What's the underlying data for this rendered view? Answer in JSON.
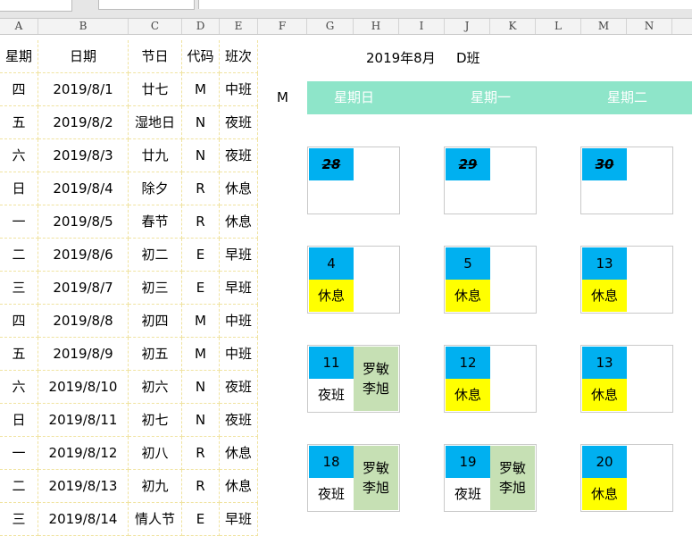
{
  "columns": [
    "A",
    "B",
    "C",
    "D",
    "E",
    "F",
    "G",
    "H",
    "I",
    "J",
    "K",
    "L",
    "M",
    "N"
  ],
  "table": {
    "headers": [
      "星期",
      "日期",
      "节日",
      "代码",
      "班次"
    ],
    "rows": [
      [
        "四",
        "2019/8/1",
        "廿七",
        "M",
        "中班"
      ],
      [
        "五",
        "2019/8/2",
        "湿地日",
        "N",
        "夜班"
      ],
      [
        "六",
        "2019/8/3",
        "廿九",
        "N",
        "夜班"
      ],
      [
        "日",
        "2019/8/4",
        "除夕",
        "R",
        "休息"
      ],
      [
        "一",
        "2019/8/5",
        "春节",
        "R",
        "休息"
      ],
      [
        "二",
        "2019/8/6",
        "初二",
        "E",
        "早班"
      ],
      [
        "三",
        "2019/8/7",
        "初三",
        "E",
        "早班"
      ],
      [
        "四",
        "2019/8/8",
        "初四",
        "M",
        "中班"
      ],
      [
        "五",
        "2019/8/9",
        "初五",
        "M",
        "中班"
      ],
      [
        "六",
        "2019/8/10",
        "初六",
        "N",
        "夜班"
      ],
      [
        "日",
        "2019/8/11",
        "初七",
        "N",
        "夜班"
      ],
      [
        "一",
        "2019/8/12",
        "初八",
        "R",
        "休息"
      ],
      [
        "二",
        "2019/8/13",
        "初九",
        "R",
        "休息"
      ],
      [
        "三",
        "2019/8/14",
        "情人节",
        "E",
        "早班"
      ]
    ]
  },
  "calendar": {
    "year_month": "2019年8月",
    "class_name": "D班",
    "code_label": "M",
    "weekdays": [
      "星期日",
      "星期一",
      "星期二"
    ],
    "weeks": [
      [
        {
          "day": "28",
          "old": true
        },
        {
          "day": "29",
          "old": true
        },
        {
          "day": "30",
          "old": true
        }
      ],
      [
        {
          "day": "4",
          "shift": "休息"
        },
        {
          "day": "5",
          "shift": "休息"
        },
        {
          "day": "13",
          "shift": "休息"
        }
      ],
      [
        {
          "day": "11",
          "shift": "夜班",
          "names": [
            "罗敏",
            "李旭"
          ]
        },
        {
          "day": "12",
          "shift": "休息"
        },
        {
          "day": "13",
          "shift": "休息"
        }
      ],
      [
        {
          "day": "18",
          "shift": "夜班",
          "names": [
            "罗敏",
            "李旭"
          ]
        },
        {
          "day": "19",
          "shift": "夜班",
          "names": [
            "罗敏",
            "李旭"
          ]
        },
        {
          "day": "20",
          "shift": "休息"
        }
      ]
    ]
  },
  "colors": {
    "accent": "#8ee5c9",
    "date_cell": "#00b0f0",
    "rest": "#ffff00",
    "names": "#c6e0b4"
  }
}
